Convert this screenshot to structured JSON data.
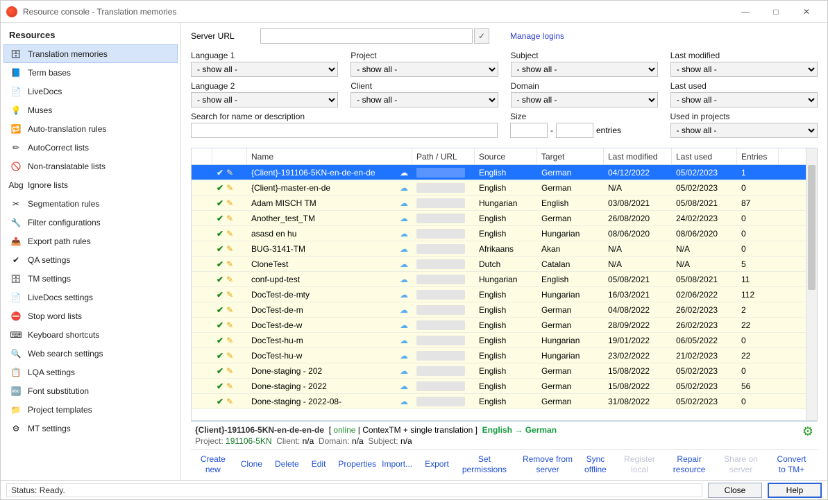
{
  "window": {
    "title": "Resource console - Translation memories",
    "minimize": "—",
    "maximize": "□",
    "close": "✕"
  },
  "sidebar": {
    "title": "Resources",
    "items": [
      {
        "label": "Translation memories",
        "selected": true
      },
      {
        "label": "Term bases"
      },
      {
        "label": "LiveDocs"
      },
      {
        "label": "Muses"
      },
      {
        "label": "Auto-translation rules"
      },
      {
        "label": "AutoCorrect lists"
      },
      {
        "label": "Non-translatable lists"
      },
      {
        "label": "Ignore lists"
      },
      {
        "label": "Segmentation rules"
      },
      {
        "label": "Filter configurations"
      },
      {
        "label": "Export path rules"
      },
      {
        "label": "QA settings"
      },
      {
        "label": "TM settings"
      },
      {
        "label": "LiveDocs settings"
      },
      {
        "label": "Stop word lists"
      },
      {
        "label": "Keyboard shortcuts"
      },
      {
        "label": "Web search settings"
      },
      {
        "label": "LQA settings"
      },
      {
        "label": "Font substitution"
      },
      {
        "label": "Project templates"
      },
      {
        "label": "MT settings"
      }
    ]
  },
  "server": {
    "label": "Server URL",
    "value": "",
    "manage": "Manage logins",
    "check": "✓"
  },
  "filters": {
    "lang1": {
      "label": "Language 1",
      "value": "- show all -"
    },
    "lang2": {
      "label": "Language 2",
      "value": "- show all -"
    },
    "project": {
      "label": "Project",
      "value": "- show all -"
    },
    "client": {
      "label": "Client",
      "value": "- show all -"
    },
    "subject": {
      "label": "Subject",
      "value": "- show all -"
    },
    "domain": {
      "label": "Domain",
      "value": "- show all -"
    },
    "lastmod": {
      "label": "Last modified",
      "value": "- show all -"
    },
    "lastused": {
      "label": "Last used",
      "value": "- show all -"
    },
    "search": {
      "label": "Search for name or description",
      "value": ""
    },
    "size": {
      "label": "Size",
      "from": "",
      "to": "",
      "unit": "entries"
    },
    "usedin": {
      "label": "Used in projects",
      "value": "- show all -"
    }
  },
  "table": {
    "columns": {
      "name": "Name",
      "path": "Path / URL",
      "source": "Source",
      "target": "Target",
      "mod": "Last modified",
      "used": "Last used",
      "entries": "Entries"
    },
    "rows": [
      {
        "name": "{Client}-191106-5KN-en-de-en-de",
        "source": "English",
        "target": "German",
        "mod": "04/12/2022",
        "used": "05/02/2023",
        "entries": "1",
        "selected": true
      },
      {
        "name": "{Client}-master-en-de",
        "source": "English",
        "target": "German",
        "mod": "N/A",
        "used": "05/02/2023",
        "entries": "0"
      },
      {
        "name": "Adam MISCH TM",
        "source": "Hungarian",
        "target": "English",
        "mod": "03/08/2021",
        "used": "05/08/2021",
        "entries": "87"
      },
      {
        "name": "Another_test_TM",
        "source": "English",
        "target": "German",
        "mod": "26/08/2020",
        "used": "24/02/2023",
        "entries": "0"
      },
      {
        "name": "asasd en hu",
        "source": "English",
        "target": "Hungarian",
        "mod": "08/06/2020",
        "used": "08/06/2020",
        "entries": "0"
      },
      {
        "name": "BUG-3141-TM",
        "source": "Afrikaans",
        "target": "Akan",
        "mod": "N/A",
        "used": "N/A",
        "entries": "0"
      },
      {
        "name": "CloneTest",
        "source": "Dutch",
        "target": "Catalan",
        "mod": "N/A",
        "used": "N/A",
        "entries": "5"
      },
      {
        "name": "conf-upd-test",
        "source": "Hungarian",
        "target": "English",
        "mod": "05/08/2021",
        "used": "05/08/2021",
        "entries": "11"
      },
      {
        "name": "DocTest-de-mty",
        "source": "English",
        "target": "Hungarian",
        "mod": "16/03/2021",
        "used": "02/06/2022",
        "entries": "112"
      },
      {
        "name": "DocTest-de-m",
        "source": "English",
        "target": "German",
        "mod": "04/08/2022",
        "used": "26/02/2023",
        "entries": "2"
      },
      {
        "name": "DocTest-de-w",
        "source": "English",
        "target": "German",
        "mod": "28/09/2022",
        "used": "26/02/2023",
        "entries": "22"
      },
      {
        "name": "DocTest-hu-m",
        "source": "English",
        "target": "Hungarian",
        "mod": "19/01/2022",
        "used": "06/05/2022",
        "entries": "0"
      },
      {
        "name": "DocTest-hu-w",
        "source": "English",
        "target": "Hungarian",
        "mod": "23/02/2022",
        "used": "21/02/2023",
        "entries": "22"
      },
      {
        "name": "Done-staging - 202",
        "source": "English",
        "target": "German",
        "mod": "15/08/2022",
        "used": "05/02/2023",
        "entries": "0"
      },
      {
        "name": "Done-staging - 2022",
        "source": "English",
        "target": "German",
        "mod": "15/08/2022",
        "used": "05/02/2023",
        "entries": "56"
      },
      {
        "name": "Done-staging - 2022-08-",
        "source": "English",
        "target": "German",
        "mod": "31/08/2022",
        "used": "05/02/2023",
        "entries": "0"
      }
    ]
  },
  "detail": {
    "name": "{Client}-191106-5KN-en-de-en-de",
    "online": "online",
    "mode": "ContexTM + single translation",
    "src": "English",
    "arrow": "→",
    "tgt": "German",
    "project_label": "Project:",
    "project": "191106-5KN",
    "client_label": "Client:",
    "client": "n/a",
    "domain_label": "Domain:",
    "domain": "n/a",
    "subject_label": "Subject:",
    "subject": "n/a"
  },
  "actions": {
    "create": "Create new",
    "clone": "Clone",
    "delete": "Delete",
    "edit": "Edit",
    "props": "Properties",
    "import": "Import...",
    "export": "Export",
    "setperm": "Set permissions",
    "remove": "Remove from server",
    "sync": "Sync offline",
    "reglocal": "Register local",
    "repair": "Repair resource",
    "share": "Share on server",
    "convert": "Convert to TM+"
  },
  "status": {
    "text": "Status: Ready.",
    "close": "Close",
    "help": "Help"
  }
}
